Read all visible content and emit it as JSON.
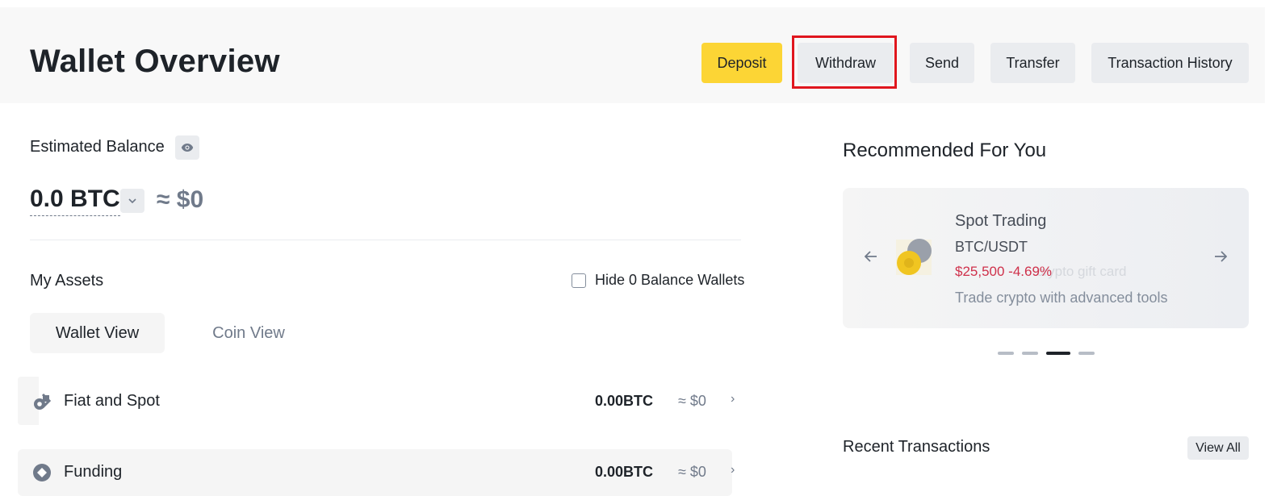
{
  "header": {
    "title": "Wallet Overview",
    "buttons": {
      "deposit": "Deposit",
      "withdraw": "Withdraw",
      "send": "Send",
      "transfer": "Transfer",
      "history": "Transaction History"
    }
  },
  "balance": {
    "label": "Estimated Balance",
    "value": "0.0 BTC",
    "usd": "≈ $0"
  },
  "assets": {
    "title": "My Assets",
    "hide_zero_label": "Hide 0 Balance Wallets",
    "hide_zero_checked": false,
    "tabs": [
      "Wallet View",
      "Coin View"
    ],
    "rows": [
      {
        "label": "Fiat and Spot",
        "btc": "0.00BTC",
        "usd": "≈ $0"
      },
      {
        "label": "Funding",
        "btc": "0.00BTC",
        "usd": "≈ $0"
      }
    ]
  },
  "recommended": {
    "title": "Recommended For You",
    "card": {
      "title": "Spot Trading",
      "pair": "BTC/USDT",
      "price": "$25,500 -4.69%",
      "ghost_text": "crypto gift card",
      "description": "Trade crypto with advanced tools"
    },
    "active_dot": 3,
    "dot_count": 4
  },
  "recent": {
    "title": "Recent Transactions",
    "view_all": "View All"
  },
  "colors": {
    "primary_yellow": "#fcd535",
    "highlight_red": "#e0161e",
    "negative_red": "#cf304a"
  }
}
